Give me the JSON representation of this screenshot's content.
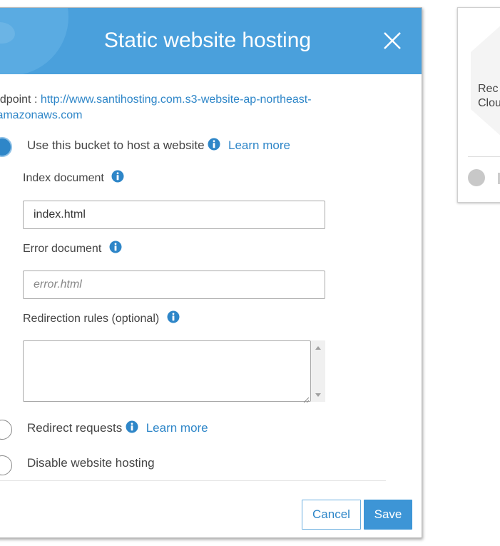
{
  "modal": {
    "title": "Static website hosting",
    "endpoint_label": "ndpoint : ",
    "endpoint_url_line1": "http://www.santihosting.com.s3-website-ap-northeast-",
    "endpoint_url_line2": ".amazonaws.com"
  },
  "options": {
    "host": {
      "label": "Use this bucket to host a website",
      "learn_more": "Learn more",
      "selected": true
    },
    "redirect": {
      "label": "Redirect requests",
      "learn_more": "Learn more",
      "selected": false
    },
    "disable": {
      "label": "Disable website hosting",
      "selected": false
    }
  },
  "fields": {
    "index": {
      "label": "Index document",
      "value": "index.html"
    },
    "error": {
      "label": "Error document",
      "placeholder": "error.html"
    },
    "redirection": {
      "label": "Redirection rules (optional)"
    }
  },
  "buttons": {
    "cancel": "Cancel",
    "save": "Save"
  },
  "background_card": {
    "line1": "Rec",
    "line2": "Clou"
  },
  "colors": {
    "header": "#4aa0dc",
    "accent": "#2e86c8",
    "save": "#3d95d6"
  }
}
